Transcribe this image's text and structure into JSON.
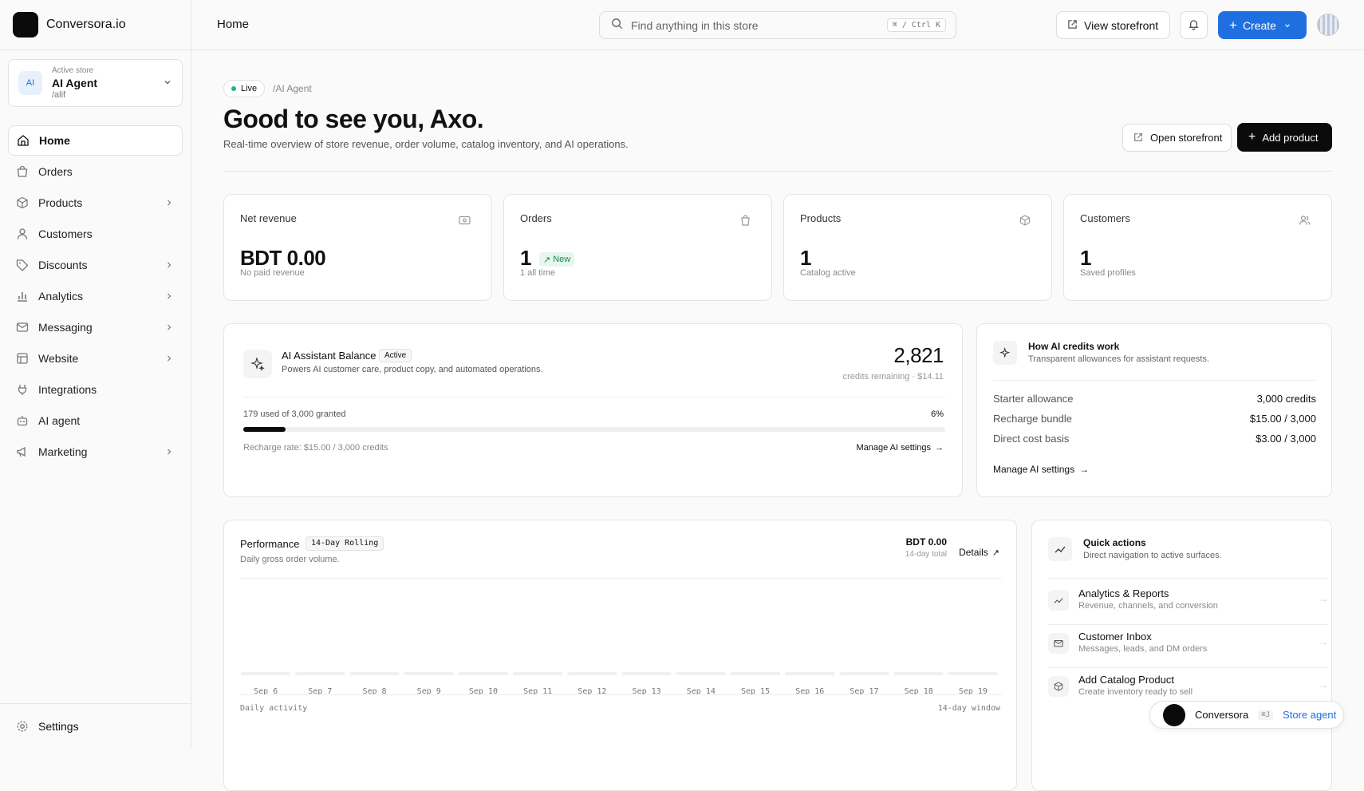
{
  "brand": {
    "name": "Conversora.io"
  },
  "store": {
    "caption": "Active store",
    "avatar": "AI",
    "name": "AI Agent",
    "slug": "/alif"
  },
  "nav": [
    {
      "label": "Home",
      "icon": "home-icon",
      "active": true,
      "chevron": false
    },
    {
      "label": "Orders",
      "icon": "bag-icon",
      "chevron": false
    },
    {
      "label": "Products",
      "icon": "box-icon",
      "chevron": true
    },
    {
      "label": "Customers",
      "icon": "user-icon",
      "chevron": false
    },
    {
      "label": "Discounts",
      "icon": "tag-icon",
      "chevron": true
    },
    {
      "label": "Analytics",
      "icon": "bar-chart-icon",
      "chevron": true
    },
    {
      "label": "Messaging",
      "icon": "mail-icon",
      "chevron": true
    },
    {
      "label": "Website",
      "icon": "website-icon",
      "chevron": true
    },
    {
      "label": "Integrations",
      "icon": "plug-icon",
      "chevron": false
    },
    {
      "label": "AI agent",
      "icon": "robot-icon",
      "chevron": false
    },
    {
      "label": "Marketing",
      "icon": "megaphone-icon",
      "chevron": true
    }
  ],
  "settings": {
    "label": "Settings"
  },
  "topbar": {
    "crumb": "Home",
    "search_placeholder": "Find anything in this store",
    "search_kbd": "⌘ / Ctrl K",
    "view_storefront": "View storefront",
    "create": "Create"
  },
  "hero": {
    "status": "Live",
    "path": "/AI Agent",
    "title": "Good to see you, Axo.",
    "subtitle": "Real-time overview of store revenue, order volume, catalog inventory, and AI operations.",
    "open_storefront": "Open storefront",
    "add_product": "Add product"
  },
  "stats": [
    {
      "label": "Net revenue",
      "value": "BDT 0.00",
      "sub": "No paid revenue",
      "icon": "money-icon"
    },
    {
      "label": "Orders",
      "value": "1",
      "sub": "1 all time",
      "badge": "New",
      "icon": "bag-icon"
    },
    {
      "label": "Products",
      "value": "1",
      "sub": "Catalog active",
      "icon": "box-icon"
    },
    {
      "label": "Customers",
      "value": "1",
      "sub": "Saved profiles",
      "icon": "users-icon"
    }
  ],
  "ai_balance": {
    "title": "AI Assistant Balance",
    "badge": "Active",
    "desc": "Powers AI customer care, product copy, and automated operations.",
    "credits": "2,821",
    "credits_sub": "credits remaining · $14.11",
    "used_text": "179 used of 3,000 granted",
    "percent": "6%",
    "progress": 0.06,
    "recharge": "Recharge rate: $15.00 / 3,000 credits",
    "link": "Manage AI settings"
  },
  "credits_info": {
    "title": "How AI credits work",
    "subtitle": "Transparent allowances for assistant requests.",
    "rows": [
      {
        "label": "Starter allowance",
        "value": "3,000 credits"
      },
      {
        "label": "Recharge bundle",
        "value": "$15.00 / 3,000"
      },
      {
        "label": "Direct cost basis",
        "value": "$3.00 / 3,000"
      }
    ],
    "link": "Manage AI settings"
  },
  "performance": {
    "title": "Performance",
    "tag": "14-Day Rolling",
    "subtitle": "Daily gross order volume.",
    "total": "BDT 0.00",
    "total_sub": "14-day total",
    "details": "Details",
    "footer_left": "Daily activity",
    "footer_right": "14-day window"
  },
  "chart_data": {
    "type": "bar",
    "categories": [
      "Sep 6",
      "Sep 7",
      "Sep 8",
      "Sep 9",
      "Sep 10",
      "Sep 11",
      "Sep 12",
      "Sep 13",
      "Sep 14",
      "Sep 15",
      "Sep 16",
      "Sep 17",
      "Sep 18",
      "Sep 19"
    ],
    "values": [
      0,
      0,
      0,
      0,
      0,
      0,
      0,
      0,
      0,
      0,
      0,
      0,
      0,
      0
    ],
    "title": "",
    "xlabel": "",
    "ylabel": ""
  },
  "quick_actions": {
    "title": "Quick actions",
    "subtitle": "Direct navigation to active surfaces.",
    "items": [
      {
        "title": "Analytics & Reports",
        "sub": "Revenue, channels, and conversion",
        "icon": "chart-icon"
      },
      {
        "title": "Customer Inbox",
        "sub": "Messages, leads, and DM orders",
        "icon": "mail-icon"
      },
      {
        "title": "Add Catalog Product",
        "sub": "Create inventory ready to sell",
        "icon": "box-icon"
      }
    ]
  },
  "agent_pill": {
    "name": "Conversora",
    "kbd": "⌘J",
    "label": "Store agent"
  }
}
